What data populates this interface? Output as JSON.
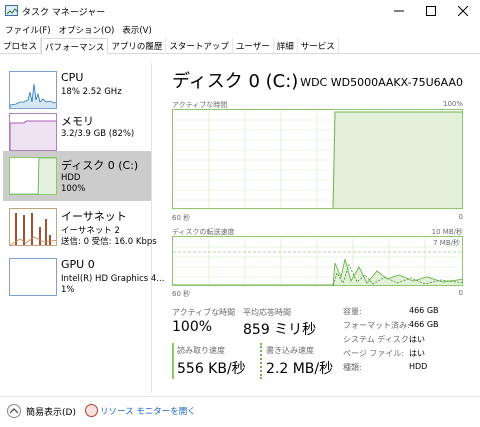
{
  "window": {
    "title": "タスク マネージャー",
    "minimize_icon": "minimize-icon",
    "maximize_icon": "maximize-icon",
    "close_icon": "close-icon"
  },
  "menu": [
    "ファイル(F)",
    "オプション(O)",
    "表示(V)"
  ],
  "tabs": [
    "プロセス",
    "パフォーマンス",
    "アプリの履歴",
    "スタートアップ",
    "ユーザー",
    "詳細",
    "サービス"
  ],
  "active_tab": "パフォーマンス",
  "sidebar": {
    "items": [
      {
        "name": "CPU",
        "line2": "18%  2.52 GHz",
        "line3": "",
        "color": "#1f78c1"
      },
      {
        "name": "メモリ",
        "line2": "3.2/3.9 GB (82%)",
        "line3": "",
        "color": "#8b2fa8"
      },
      {
        "name": "ディスク 0 (C:)",
        "line2": "HDD",
        "line3": "100%",
        "color": "#4caf50"
      },
      {
        "name": "イーサネット",
        "line2": "イーサネット 2",
        "line3": "送信: 0 受信: 16.0 Kbps",
        "color": "#a0522d"
      },
      {
        "name": "GPU 0",
        "line2": "Intel(R) HD Graphics 4...",
        "line3": "1%",
        "color": "#1f78c1"
      }
    ],
    "selected_index": 2
  },
  "main": {
    "title": "ディスク 0 (C:)",
    "model": "WDC WD5000AAKX-75U6AA0",
    "graph1": {
      "label": "アクティブな時間",
      "max_label": "100%",
      "xlabel_left": "60 秒",
      "xlabel_right": "0",
      "accent": "#8cc86b"
    },
    "graph2": {
      "label": "ディスクの転送速度",
      "max_label": "10 MB/秒",
      "inner_label": "7 MB/秒",
      "xlabel_left": "60 秒",
      "xlabel_right": "0"
    },
    "stats": {
      "active_label": "アクティブな時間",
      "active_value": "100%",
      "response_label": "平均応答時間",
      "response_value": "859 ミリ秒",
      "read_label": "読み取り速度",
      "read_value": "556 KB/秒",
      "write_label": "書き込み速度",
      "write_value": "2.2 MB/秒"
    },
    "properties": [
      {
        "label": "容量:",
        "value": "466 GB"
      },
      {
        "label": "フォーマット済み:",
        "value": "466 GB"
      },
      {
        "label": "システム ディスク:",
        "value": "はい"
      },
      {
        "label": "ページ ファイル:",
        "value": "はい"
      },
      {
        "label": "種類:",
        "value": "HDD"
      }
    ]
  },
  "footer": {
    "fewer_details": "簡易表示(D)",
    "resource_monitor": "リソース モニターを開く"
  }
}
